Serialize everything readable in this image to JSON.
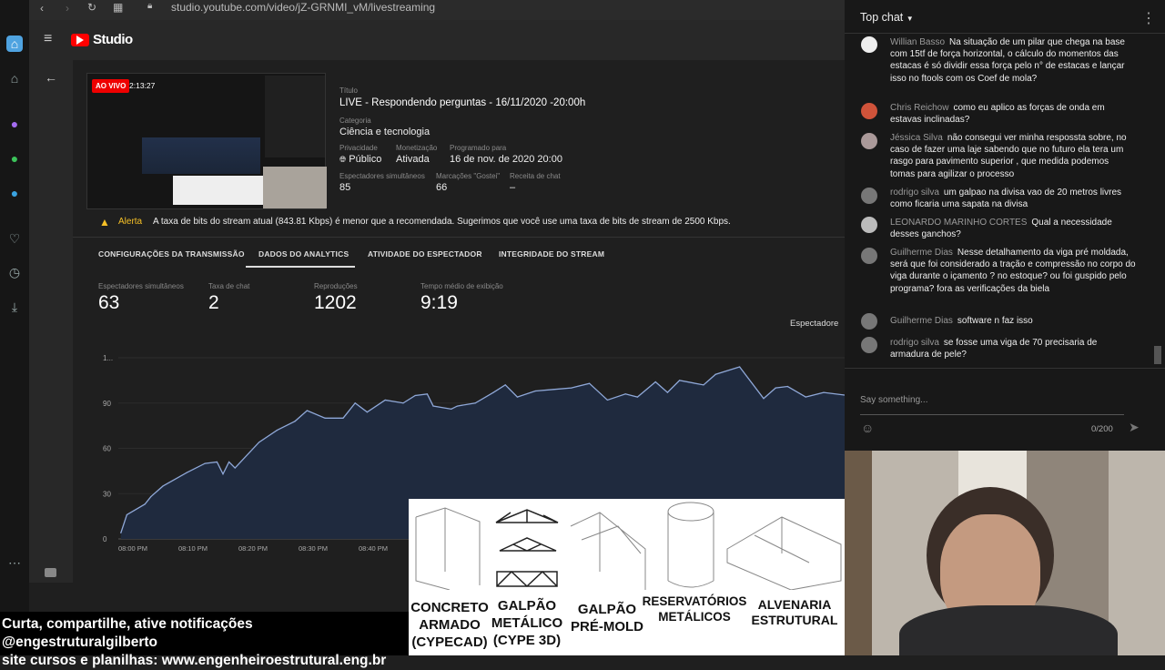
{
  "browser": {
    "url": "studio.youtube.com/video/jZ-GRNMI_vM/livestreaming"
  },
  "studio": {
    "logo": "Studio"
  },
  "stream": {
    "badge": "AO VIVO",
    "elapsed": "2:13:27",
    "title_label": "Título",
    "title": "LIVE - Respondendo perguntas - 16/11/2020 -20:00h",
    "category_label": "Categoria",
    "category": "Ciência e tecnologia",
    "privacy_label": "Privacidade",
    "privacy": "Público",
    "monetization_label": "Monetização",
    "monetization": "Ativada",
    "scheduled_label": "Programado para",
    "scheduled": "16 de nov. de 2020 20:00",
    "concurrent_label": "Espectadores simultâneos",
    "concurrent": "85",
    "likes_label": "Marcações \"Gostei\"",
    "likes": "66",
    "revenue_label": "Receita de chat",
    "revenue": "–"
  },
  "alert": {
    "label": "Alerta",
    "text": "A taxa de bits do stream atual (843.81 Kbps) é menor que a recomendada. Sugerimos que você use uma taxa de bits de stream de 2500 Kbps."
  },
  "tabs": [
    {
      "label": "CONFIGURAÇÕES DA TRANSMISSÃO"
    },
    {
      "label": "DADOS DO ANALYTICS",
      "active": true
    },
    {
      "label": "ATIVIDADE DO ESPECTADOR"
    },
    {
      "label": "INTEGRIDADE DO STREAM"
    }
  ],
  "stats": [
    {
      "label": "Espectadores simultâneos",
      "value": "63"
    },
    {
      "label": "Taxa de chat",
      "value": "2"
    },
    {
      "label": "Reproduções",
      "value": "1202"
    },
    {
      "label": "Tempo médio de exibição",
      "value": "9:19"
    }
  ],
  "chart_selector": "Espectadore",
  "chart_data": {
    "type": "area",
    "ylabels": [
      "0",
      "30",
      "60",
      "90",
      "1..."
    ],
    "yticks": [
      0,
      30,
      60,
      90,
      120
    ],
    "ylim": [
      0,
      120
    ],
    "xlabels": [
      "08:00 PM",
      "08:10 PM",
      "08:20 PM",
      "08:30 PM",
      "08:40 PM"
    ],
    "color": "#8fa8d8",
    "x": [
      "19:58",
      "19:59",
      "20:02",
      "20:03",
      "20:05",
      "20:09",
      "20:12",
      "20:14",
      "20:15",
      "20:16",
      "20:17",
      "20:21",
      "20:24",
      "20:27",
      "20:29",
      "20:32",
      "20:35",
      "20:37",
      "20:39",
      "20:42",
      "20:45",
      "20:47",
      "20:49",
      "20:50",
      "20:53",
      "20:54",
      "20:57",
      "21:00",
      "21:02",
      "21:04",
      "21:07",
      "21:10",
      "21:13",
      "21:16",
      "21:19",
      "21:22",
      "21:24",
      "21:27",
      "21:29",
      "21:31",
      "21:35",
      "21:37",
      "21:41",
      "21:45",
      "21:47",
      "21:49",
      "21:52",
      "21:55",
      "21:59"
    ],
    "y": [
      4,
      16,
      23,
      28,
      35,
      44,
      50,
      51,
      43,
      51,
      47,
      64,
      72,
      78,
      85,
      80,
      80,
      90,
      84,
      92,
      90,
      95,
      96,
      88,
      86,
      88,
      90,
      97,
      102,
      94,
      98,
      99,
      100,
      103,
      92,
      96,
      94,
      104,
      97,
      105,
      102,
      109,
      114,
      93,
      100,
      101,
      94,
      97,
      95
    ]
  },
  "chat": {
    "header": "Top chat",
    "messages": [
      {
        "author": "Willian Basso",
        "text": "Na situação de um pilar que chega na base com 15tf de força horizontal, o cálculo do momentos das estacas é só dividir essa força pelo n° de estacas e lançar isso no ftools com os Coef de mola?"
      },
      {
        "author": "Chris Reichow",
        "text": "como eu aplico as forças de onda em estavas inclinadas?"
      },
      {
        "author": "Jéssica Silva",
        "text": "não consegui ver minha respossta sobre, no caso de fazer uma laje sabendo que no futuro ela tera um rasgo para pavimento superior , que medida podemos tomas para agilizar o processo"
      },
      {
        "author": "rodrigo silva",
        "text": "um galpao na divisa vao de 20 metros livres como ficaria uma sapata na divisa"
      },
      {
        "author": "LEONARDO MARINHO CORTES",
        "text": "Qual a necessidade desses ganchos?"
      },
      {
        "author": "Guilherme Dias",
        "text": "Nesse detalhamento da viga pré moldada, será que foi considerado a tração e compressão no corpo do viga durante o içamento ? no estoque? ou foi guspido pelo programa? fora as verificações da biela"
      },
      {
        "author": "Guilherme Dias",
        "text": "software n faz isso"
      },
      {
        "author": "rodrigo silva",
        "text": "se fosse uma viga de 70 precisaria de armadura de pele?"
      }
    ],
    "input_placeholder": "Say something...",
    "counter": "0/200"
  },
  "overlay": {
    "items": [
      "CONCRETO ARMADO (CYPECAD)",
      "GALPÃO METÁLICO (CYPE 3D)",
      "GALPÃO PRÉ-MOLD",
      "RESERVATÓRIOS METÁLICOS",
      "ALVENARIA ESTRUTURAL"
    ]
  },
  "promo": {
    "line1": "Curta, compartilhe, ative notificações @engestruturalgilberto",
    "line2": "site cursos e planilhas: www.engenheiroestrutural.eng.br"
  }
}
